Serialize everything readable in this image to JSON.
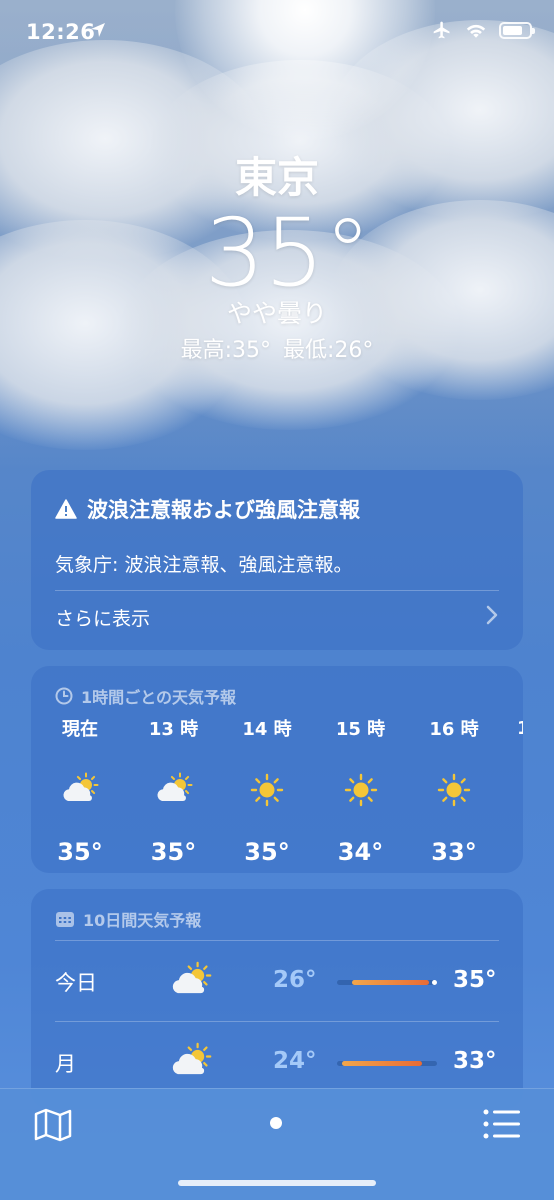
{
  "status_bar": {
    "time": "12:26",
    "battery_level": 0.75,
    "airplane_mode": true,
    "wifi": true
  },
  "header": {
    "city": "東京",
    "temperature": "35°",
    "condition": "やや曇り",
    "high": "最高:35°",
    "low": "最低:26°"
  },
  "alert": {
    "title": "波浪注意報および強風注意報",
    "description": "気象庁: 波浪注意報、強風注意報。",
    "more_label": "さらに表示"
  },
  "hourly": {
    "title": "1時間ごとの天気予報",
    "items": [
      {
        "time": "現在",
        "icon": "partly-cloudy-icon",
        "temp": "35°"
      },
      {
        "time": "13 時",
        "icon": "partly-cloudy-icon",
        "temp": "35°"
      },
      {
        "time": "14 時",
        "icon": "sunny-icon",
        "temp": "35°"
      },
      {
        "time": "15 時",
        "icon": "sunny-icon",
        "temp": "34°"
      },
      {
        "time": "16 時",
        "icon": "sunny-icon",
        "temp": "33°"
      }
    ]
  },
  "daily": {
    "title": "10日間天気予報",
    "items": [
      {
        "day": "今日",
        "icon": "partly-cloudy-icon",
        "low": "26°",
        "high": "35°",
        "bar_start": 0.15,
        "bar_end": 0.92,
        "current": 0.97
      },
      {
        "day": "月",
        "icon": "partly-cloudy-icon",
        "low": "24°",
        "high": "33°",
        "bar_start": 0.05,
        "bar_end": 0.85
      }
    ]
  },
  "colors": {
    "accent_orange": "#e86b35",
    "accent_yellow": "#f2c23b",
    "card_blue": "#3a70c4"
  }
}
